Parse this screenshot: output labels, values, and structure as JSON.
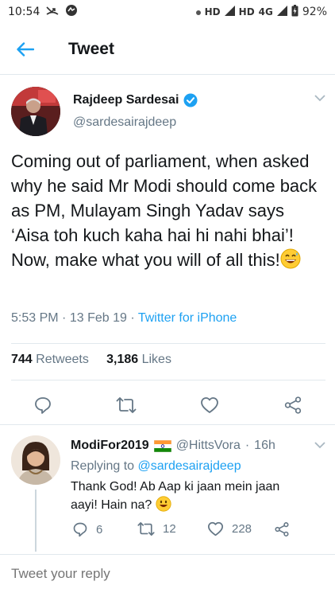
{
  "status_bar": {
    "time": "10:54",
    "network_label_1": "HD",
    "network_label_2": "HD",
    "network_type": "4G",
    "battery": "92%"
  },
  "header": {
    "title": "Tweet",
    "back_icon": "arrow-left-icon"
  },
  "tweet": {
    "author_name": "Rajdeep Sardesai",
    "verified": true,
    "handle": "@sardesairajdeep",
    "text": "Coming out of parliament, when asked why he said Mr Modi should come back as PM, Mulayam Singh Yadav says ‘Aisa toh kuch kaha hai hi nahi bhai’! Now, make what you will of all this!",
    "emoji": "grinning-sweat-emoji",
    "time": "5:53 PM",
    "date": "13 Feb 19",
    "source": "Twitter for iPhone",
    "retweets_count": "744",
    "retweets_label": "Retweets",
    "likes_count": "3,186",
    "likes_label": "Likes"
  },
  "reply": {
    "name": "ModiFor2019",
    "flag": "india-flag-icon",
    "handle": "@HittsVora",
    "age": "16h",
    "replying_prefix": "Replying to",
    "replying_to": "@sardesairajdeep",
    "text": "Thank God! Ab Aap ki jaan mein jaan aayi! Hain na?",
    "emoji": "smiley-emoji",
    "reply_count": "6",
    "retweet_count": "12",
    "like_count": "228"
  },
  "composer": {
    "placeholder": "Tweet your reply"
  },
  "colors": {
    "accent": "#1da1f2",
    "muted": "#657786",
    "text": "#14171a",
    "divider": "#e1e8ed"
  }
}
